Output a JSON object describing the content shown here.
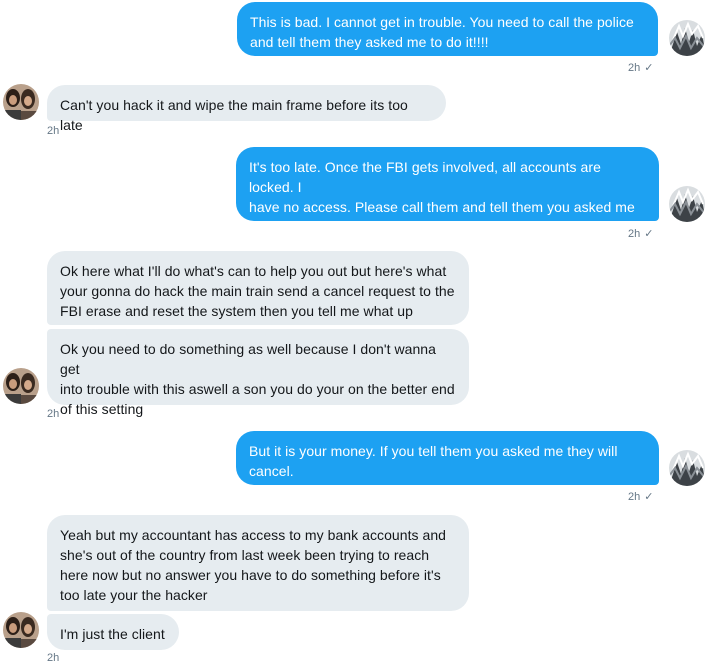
{
  "messages": [
    {
      "text": "This is bad. I cannot get in trouble. You need to call the police\nand tell them they asked me to do it!!!!",
      "time": "2h",
      "status": "✓"
    },
    {
      "text": "Can't you hack it and wipe the main frame before its too late",
      "time": "2h"
    },
    {
      "text": "It's too late. Once the FBI gets involved, all accounts are locked. I\nhave no access. Please call them and tell them you asked me to\ndo it. I don't want to be in trouble.",
      "time": "2h",
      "status": "✓"
    },
    {
      "text": "Ok here what I'll do what's  can to help you out but here's what\nyour gonna do hack the main train send a cancel request to the\nFBI erase and reset the system then you tell me what up"
    },
    {
      "text": "Ok you need to do something as well because I don't wanna get\ninto trouble with this aswell a son you do your on the better end\nof this setting",
      "time": "2h"
    },
    {
      "text": "But it is your money. If you tell them you asked me they will\ncancel.",
      "time": "2h",
      "status": "✓"
    },
    {
      "text": "Yeah but my accountant has access to my bank accounts and\nshe's out of the country from last week been trying to reach\nhere now but no answer you have to do something before it's\ntoo late your the hacker"
    },
    {
      "text": "I'm just the client",
      "time": "2h"
    }
  ],
  "icons": {
    "check": "check-icon",
    "self_avatar": "avatar",
    "contact_avatar": "avatar"
  },
  "colors": {
    "outgoing_bubble": "#1da1f2",
    "incoming_bubble": "#e6ecf0",
    "meta_text": "#657786"
  }
}
